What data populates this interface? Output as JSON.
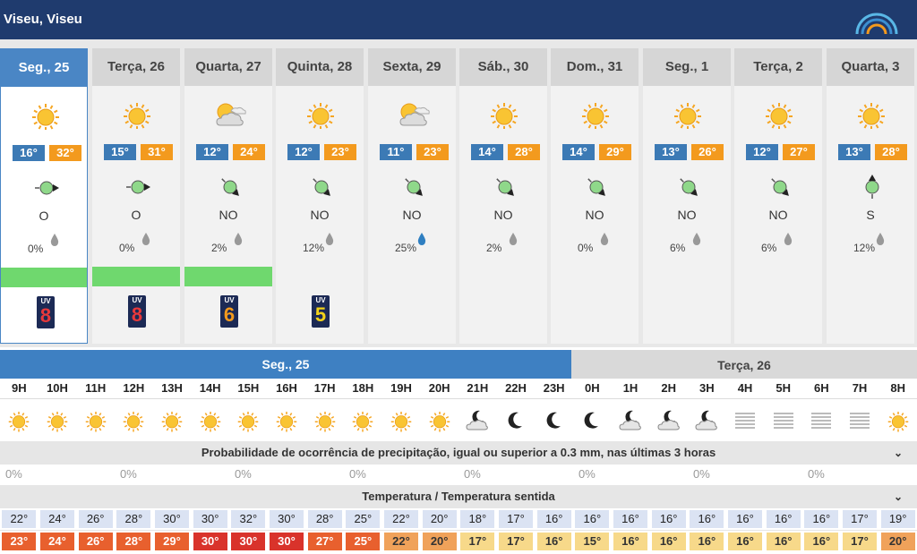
{
  "location": "Viseu, Viseu",
  "days": [
    {
      "label": "Seg., 25",
      "tmin": "16°",
      "tmax": "32°",
      "wind_dir": "O",
      "precip": "0%",
      "icon": "sun-icon",
      "uv": "8",
      "uv_color": "#e8393b",
      "has_uv": true,
      "green": true,
      "selected": true
    },
    {
      "label": "Terça, 26",
      "tmin": "15°",
      "tmax": "31°",
      "wind_dir": "O",
      "precip": "0%",
      "icon": "sun-icon",
      "uv": "8",
      "uv_color": "#e8393b",
      "has_uv": true,
      "green": true
    },
    {
      "label": "Quarta, 27",
      "tmin": "12°",
      "tmax": "24°",
      "wind_dir": "NO",
      "precip": "2%",
      "icon": "sun-cloud-icon",
      "uv": "6",
      "uv_color": "#f39a1e",
      "has_uv": true,
      "green": true
    },
    {
      "label": "Quinta, 28",
      "tmin": "12°",
      "tmax": "23°",
      "wind_dir": "NO",
      "precip": "12%",
      "icon": "sun-icon",
      "uv": "5",
      "uv_color": "#f2d21a",
      "has_uv": true
    },
    {
      "label": "Sexta, 29",
      "tmin": "11°",
      "tmax": "23°",
      "wind_dir": "NO",
      "precip": "25%",
      "icon": "sun-cloud-icon",
      "blue_drop": true
    },
    {
      "label": "Sáb., 30",
      "tmin": "14°",
      "tmax": "28°",
      "wind_dir": "NO",
      "precip": "2%",
      "icon": "sun-icon"
    },
    {
      "label": "Dom., 31",
      "tmin": "14°",
      "tmax": "29°",
      "wind_dir": "NO",
      "precip": "0%",
      "icon": "sun-icon"
    },
    {
      "label": "Seg., 1",
      "tmin": "13°",
      "tmax": "26°",
      "wind_dir": "NO",
      "precip": "6%",
      "icon": "sun-icon"
    },
    {
      "label": "Terça, 2",
      "tmin": "12°",
      "tmax": "27°",
      "wind_dir": "NO",
      "precip": "6%",
      "icon": "sun-icon"
    },
    {
      "label": "Quarta, 3",
      "tmin": "13°",
      "tmax": "28°",
      "wind_dir": "S",
      "precip": "12%",
      "icon": "sun-icon"
    }
  ],
  "hourly": {
    "day1_label": "Seg., 25",
    "day2_label": "Terça, 26",
    "hours": [
      "9H",
      "10H",
      "11H",
      "12H",
      "13H",
      "14H",
      "15H",
      "16H",
      "17H",
      "18H",
      "19H",
      "20H",
      "21H",
      "22H",
      "23H",
      "0H",
      "1H",
      "2H",
      "3H",
      "4H",
      "5H",
      "6H",
      "7H",
      "8H"
    ],
    "icons": [
      "sun-icon",
      "sun-icon",
      "sun-icon",
      "sun-icon",
      "sun-icon",
      "sun-icon",
      "sun-icon",
      "sun-icon",
      "sun-icon",
      "sun-icon",
      "sun-icon",
      "sun-icon",
      "moon-cloud-icon",
      "moon-icon",
      "moon-icon",
      "moon-icon",
      "moon-cloud-icon",
      "moon-cloud-icon",
      "moon-cloud-icon",
      "fog-icon",
      "fog-icon",
      "fog-icon",
      "fog-icon",
      "sun-icon"
    ],
    "precip_title": "Probabilidade de ocorrência de precipitação, igual ou superior a 0.3 mm, nas últimas 3 horas",
    "precip": [
      "0%",
      "0%",
      "0%",
      "0%",
      "0%",
      "0%",
      "0%",
      "0%"
    ],
    "temp_title": "Temperatura / Temperatura sentida",
    "temps": [
      "22°",
      "24°",
      "26°",
      "28°",
      "30°",
      "30°",
      "32°",
      "30°",
      "28°",
      "25°",
      "22°",
      "20°",
      "18°",
      "17°",
      "16°",
      "16°",
      "16°",
      "16°",
      "16°",
      "16°",
      "16°",
      "16°",
      "17°",
      "19°"
    ],
    "feels": [
      "23°",
      "24°",
      "26°",
      "28°",
      "29°",
      "30°",
      "30°",
      "30°",
      "27°",
      "25°",
      "22°",
      "20°",
      "17°",
      "17°",
      "16°",
      "15°",
      "16°",
      "16°",
      "16°",
      "16°",
      "16°",
      "16°",
      "17°",
      "20°"
    ]
  },
  "colors": {
    "header": "#1f3b6e",
    "selected": "#4a86c5",
    "tmin": "#3c7ab5",
    "tmax": "#f39a1e",
    "feels_30": "#d9332b",
    "feels_hot": "#e8602e",
    "feels_warm": "#f0a25a",
    "feels_mild": "#f7d98a"
  }
}
